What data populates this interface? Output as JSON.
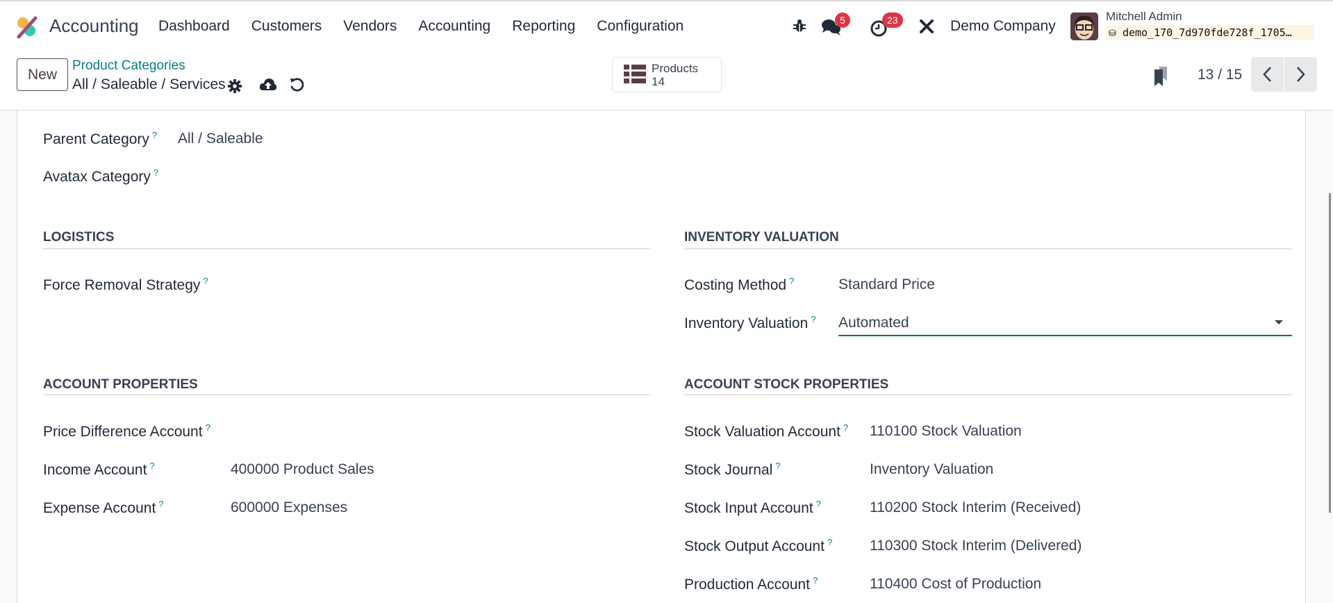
{
  "navbar": {
    "app_name": "Accounting",
    "menu": [
      "Dashboard",
      "Customers",
      "Vendors",
      "Accounting",
      "Reporting",
      "Configuration"
    ],
    "messages_count": "5",
    "activities_count": "23",
    "company": "Demo Company",
    "user_name": "Mitchell Admin",
    "database": "demo_170_7d970fde728f_1705…",
    "icons": [
      "debug-icon",
      "chat-icon",
      "activity-clock-icon",
      "tools-icon"
    ]
  },
  "control": {
    "new_label": "New",
    "breadcrumb_parent": "Product Categories",
    "record_title": "All / Saleable / Services",
    "smart_button": {
      "label": "Products",
      "count": "14"
    },
    "pager": "13 / 15"
  },
  "form": {
    "top_fields": [
      {
        "label": "Parent Category",
        "value": "All / Saleable"
      },
      {
        "label": "Avatax Category",
        "value": ""
      }
    ],
    "logistics": {
      "title": "LOGISTICS",
      "fields": [
        {
          "label": "Force Removal Strategy",
          "value": ""
        }
      ]
    },
    "inventory_valuation": {
      "title": "INVENTORY VALUATION",
      "fields": [
        {
          "label": "Costing Method",
          "value": "Standard Price"
        },
        {
          "label": "Inventory Valuation",
          "value": "Automated"
        }
      ]
    },
    "account_properties": {
      "title": "ACCOUNT PROPERTIES",
      "fields": [
        {
          "label": "Price Difference Account",
          "value": ""
        },
        {
          "label": "Income Account",
          "value": "400000 Product Sales"
        },
        {
          "label": "Expense Account",
          "value": "600000 Expenses"
        }
      ]
    },
    "account_stock_properties": {
      "title": "ACCOUNT STOCK PROPERTIES",
      "fields": [
        {
          "label": "Stock Valuation Account",
          "value": "110100 Stock Valuation"
        },
        {
          "label": "Stock Journal",
          "value": "Inventory Valuation"
        },
        {
          "label": "Stock Input Account",
          "value": "110200 Stock Interim (Received)"
        },
        {
          "label": "Stock Output Account",
          "value": "110300 Stock Interim (Delivered)"
        },
        {
          "label": "Production Account",
          "value": "110400 Cost of Production"
        }
      ]
    },
    "help_marker": "?"
  },
  "colors": {
    "accent": "#017e84",
    "badge": "#dc3545",
    "brand": "#714b67"
  }
}
